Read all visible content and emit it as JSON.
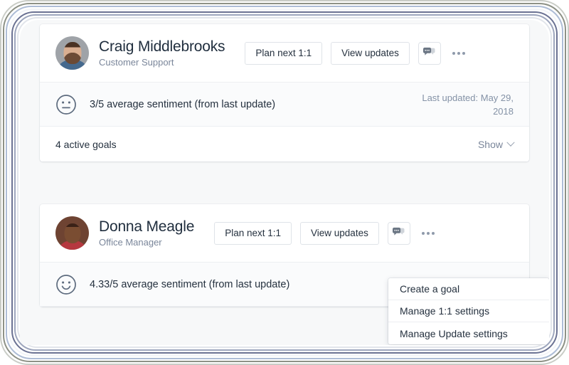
{
  "cards": [
    {
      "name": "Craig Middlebrooks",
      "role": "Customer Support",
      "avatar_icon": "avatar-photo-craig",
      "plan_label": "Plan next 1:1",
      "updates_label": "View updates",
      "chat_icon": "speech-bubbles-icon",
      "more_icon": "kebab-more-icon",
      "sentiment_icon": "neutral-face-icon",
      "sentiment_text": "3/5 average sentiment (from last update)",
      "last_updated": "Last updated: May 29, 2018",
      "goals_label": "4 active goals",
      "show_label": "Show",
      "chevron_icon": "chevron-down-icon"
    },
    {
      "name": "Donna Meagle",
      "role": "Office Manager",
      "avatar_icon": "avatar-photo-donna",
      "plan_label": "Plan next 1:1",
      "updates_label": "View updates",
      "chat_icon": "speech-bubbles-icon",
      "more_icon": "kebab-more-icon",
      "sentiment_icon": "happy-face-icon",
      "sentiment_text": "4.33/5 average sentiment (from last update)"
    }
  ],
  "menu": {
    "items": [
      {
        "label": "Create a goal"
      },
      {
        "label": "Manage 1:1 settings"
      },
      {
        "label": "Manage Update settings"
      }
    ]
  },
  "colors": {
    "card_background": "#ffffff",
    "page_background": "#f7f8f9",
    "section_background": "#fafbfc",
    "text_primary": "#25313f",
    "text_muted": "#7a869a",
    "border": "#dfe3e8",
    "icon_gray": "#6b7684"
  }
}
